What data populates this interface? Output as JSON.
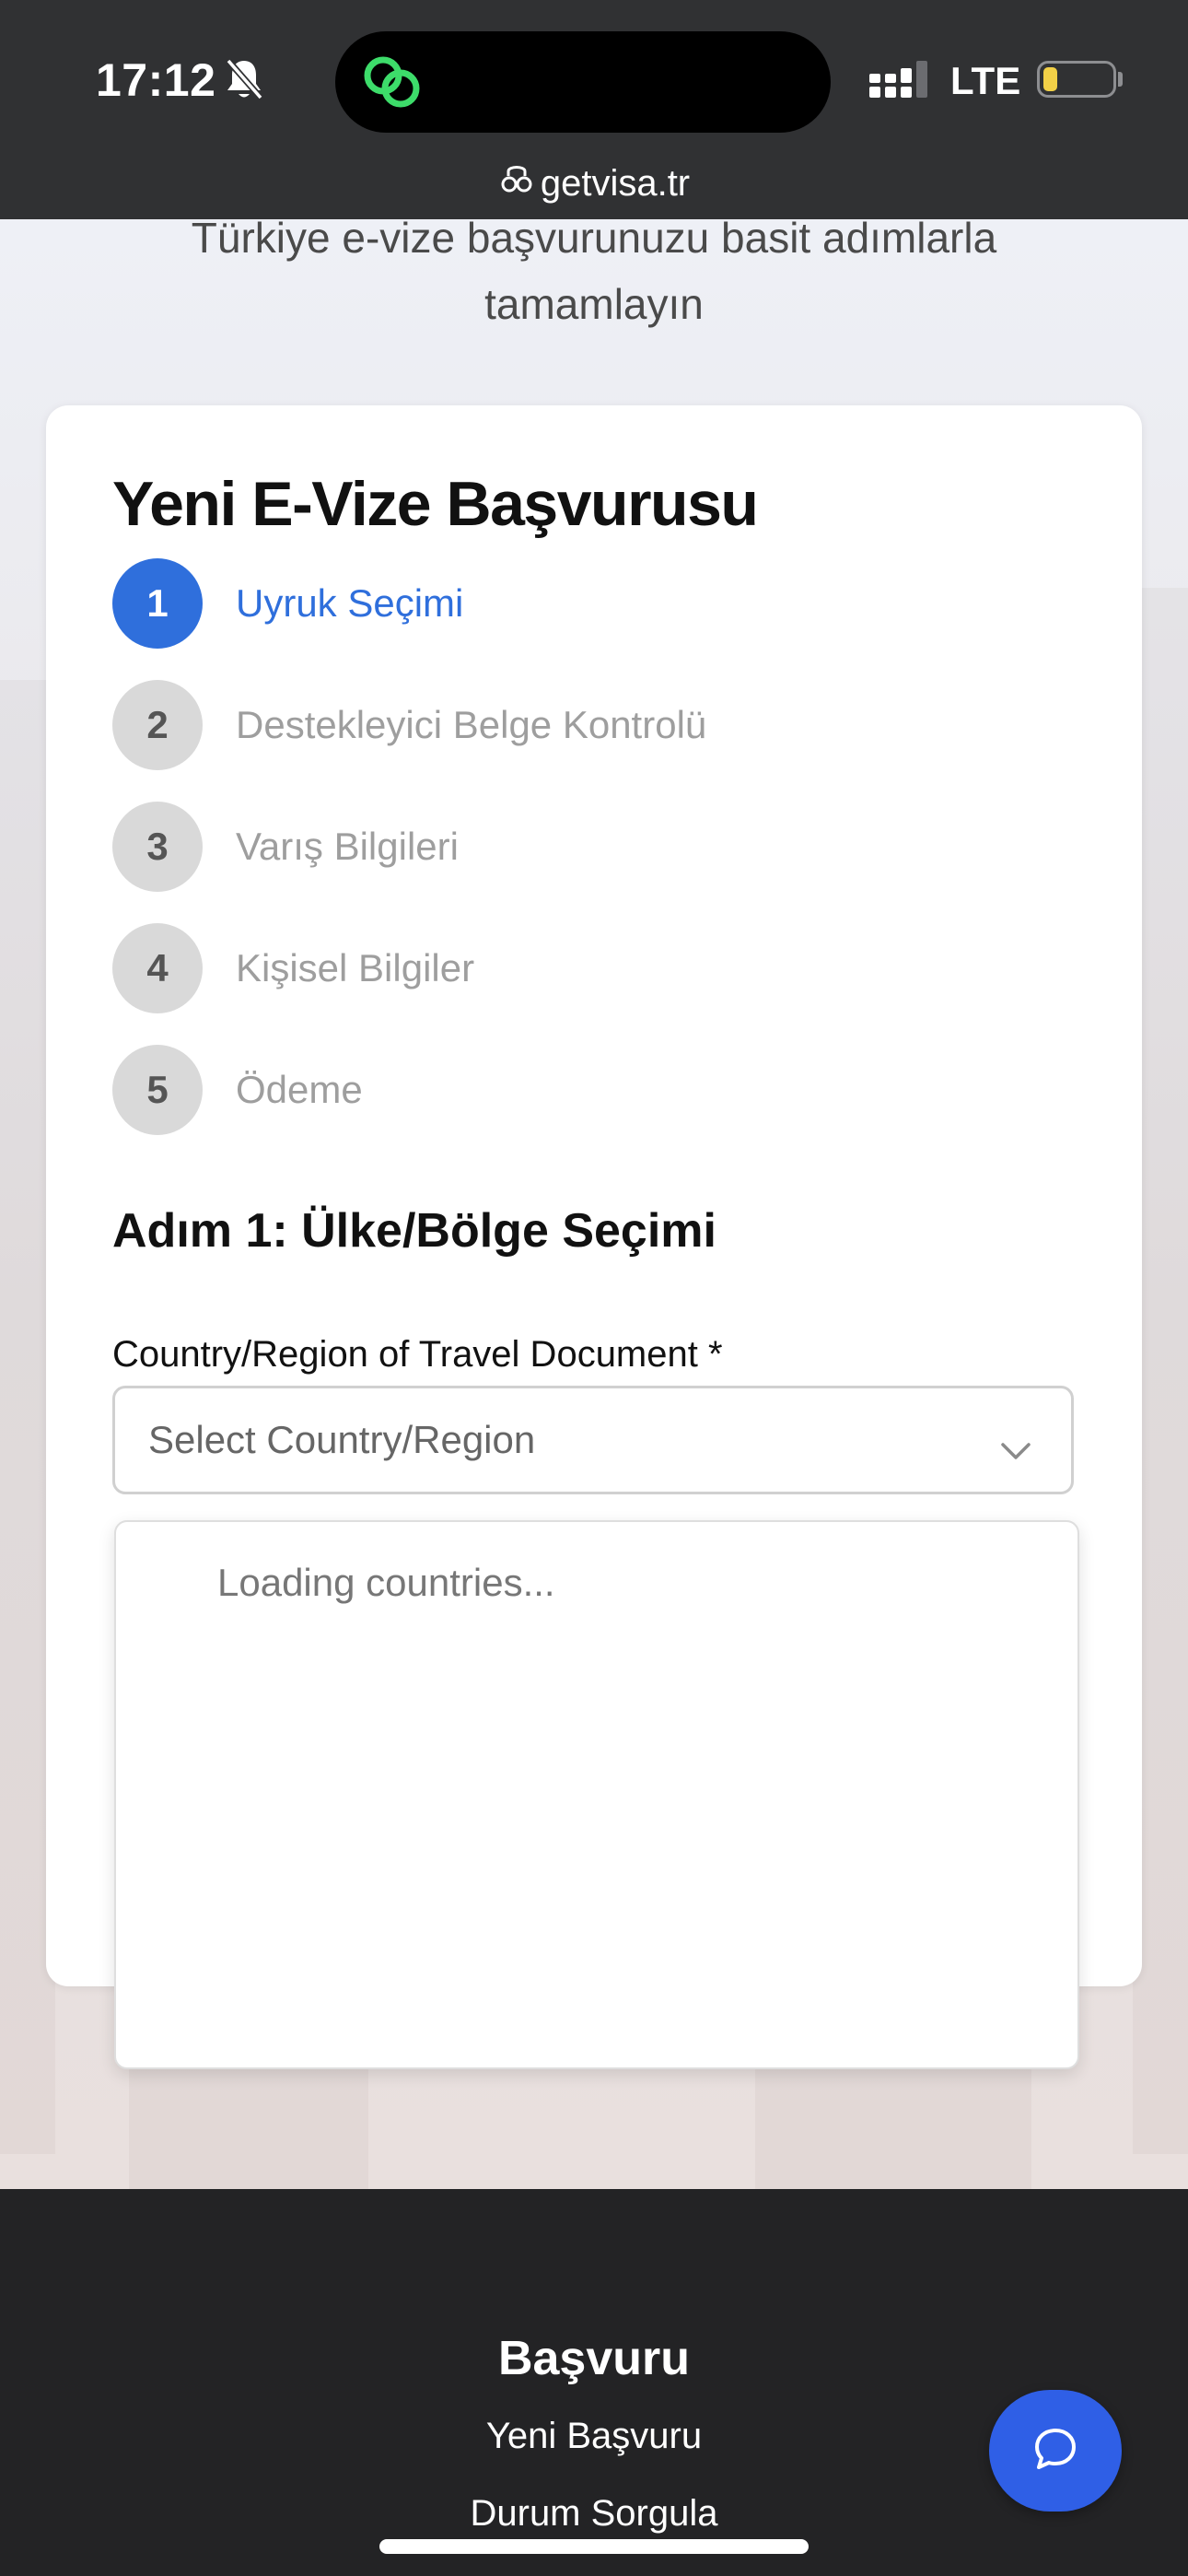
{
  "status_bar": {
    "time": "17:12",
    "network": "LTE",
    "url": "getvisa.tr"
  },
  "hero": {
    "subtitle": "Türkiye e-vize başvurunuzu basit adımlarla tamamlayın"
  },
  "form": {
    "title": "Yeni E-Vize Başvurusu",
    "steps": [
      {
        "number": "1",
        "label": "Uyruk Seçimi",
        "active": true
      },
      {
        "number": "2",
        "label": "Destekleyici Belge Kontrolü",
        "active": false
      },
      {
        "number": "3",
        "label": "Varış Bilgileri",
        "active": false
      },
      {
        "number": "4",
        "label": "Kişisel Bilgiler",
        "active": false
      },
      {
        "number": "5",
        "label": "Ödeme",
        "active": false
      }
    ],
    "step_heading": "Adım 1: Ülke/Bölge Seçimi",
    "country_label": "Country/Region of Travel Document *",
    "country_placeholder": "Select Country/Region",
    "dropdown_status": "Loading countries..."
  },
  "footer": {
    "title": "Başvuru",
    "links": [
      "Yeni Başvuru",
      "Durum Sorgula"
    ]
  },
  "colors": {
    "accent": "#2f6fdc",
    "chat_button": "#2f5fe6",
    "status_bar_bg": "#303133",
    "footer_bg": "#232325",
    "inactive_step": "#d9d9d9"
  },
  "icons": [
    "bell-slash-icon",
    "link-app-icon",
    "signal-icon",
    "battery-icon",
    "lock-icon",
    "chevron-down-icon",
    "chat-bubble-icon"
  ]
}
